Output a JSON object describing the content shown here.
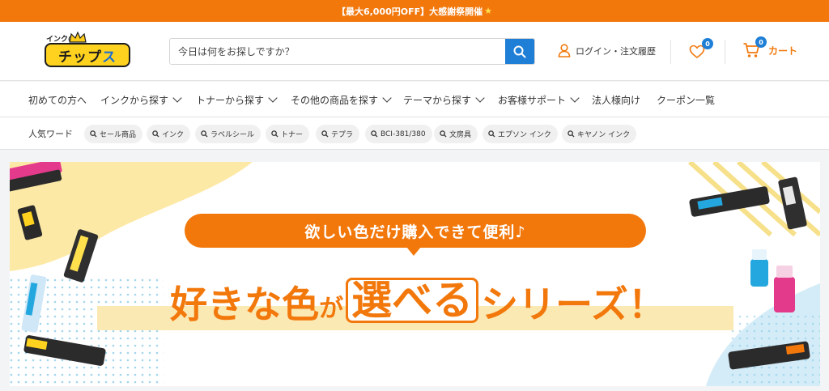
{
  "promo": {
    "text": "【最大6,000円OFF】大感謝祭開催",
    "star": "★"
  },
  "logo": {
    "small": "インクの",
    "main_part1": "チップ",
    "main_part2": "ス"
  },
  "search": {
    "placeholder": "今日は何をお探しですか？"
  },
  "account": {
    "login_label": "ログイン・注文履歴"
  },
  "wishlist": {
    "count": "0"
  },
  "cart": {
    "label": "カート",
    "count": "0"
  },
  "nav": {
    "items": [
      {
        "label": "初めての方へ"
      },
      {
        "label": "インクから探す"
      },
      {
        "label": "トナーから探す"
      },
      {
        "label": "その他の商品を探す"
      },
      {
        "label": "テーマから探す"
      },
      {
        "label": "お客様サポート"
      },
      {
        "label": "法人様向け"
      },
      {
        "label": "クーポン一覧"
      }
    ]
  },
  "keywords": {
    "label": "人気ワード",
    "items": [
      "セール商品",
      "インク",
      "ラベルシール",
      "トナー",
      "テプラ",
      "BCI-381/380",
      "文房具",
      "エプソン インク",
      "キヤノン インク"
    ]
  },
  "banner": {
    "tagline": "欲しい色だけ購入できて便利♪",
    "h_a": "好きな色",
    "h_b": "が",
    "h_c": "選べる",
    "h_d": "シリーズ！",
    "colors": {
      "accent": "#f2780c",
      "dots": "#8ccbe8",
      "stripes": "#f7e08a"
    }
  },
  "colors": {
    "brand_orange": "#f2780c",
    "brand_blue": "#1f7fd6"
  }
}
